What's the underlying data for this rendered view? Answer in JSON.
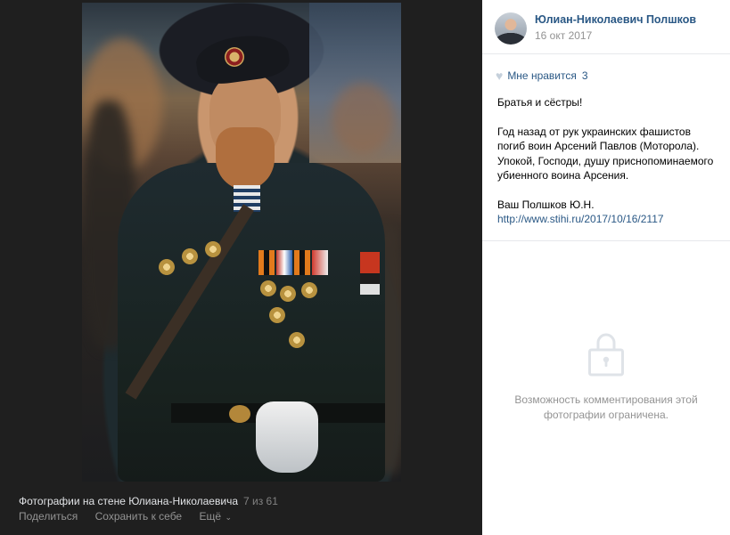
{
  "photo": {
    "caption": "Фотографии на стене Юлиана-Николаевича",
    "counter": "7 из 61",
    "actions": {
      "share": "Поделиться",
      "save": "Сохранить к себе",
      "more": "Ещё"
    }
  },
  "post": {
    "author": "Юлиан-Николаевич Полшков",
    "date": "16 окт 2017",
    "like_label": "Мне нравится",
    "like_count": "3",
    "text": {
      "p1": "Братья и сёстры!",
      "p2": "Год назад от рук украинских фашистов погиб воин Арсений Павлов (Моторола). Упокой, Господи, душу приснопоминаемого убиенного воина Арсения.",
      "p3_signature": "Ваш Полшков Ю.Н.",
      "p3_link": "http://www.stihi.ru/2017/10/16/2117"
    },
    "comments_restricted": "Возможность комментирования этой фотографии ограничена."
  },
  "icons": [
    "heart-icon",
    "lock-icon",
    "chevron-down-icon"
  ],
  "colors": {
    "link": "#2a5885",
    "muted": "#939393",
    "viewer_bg": "#1f1f1f",
    "panel_bg": "#ffffff"
  }
}
